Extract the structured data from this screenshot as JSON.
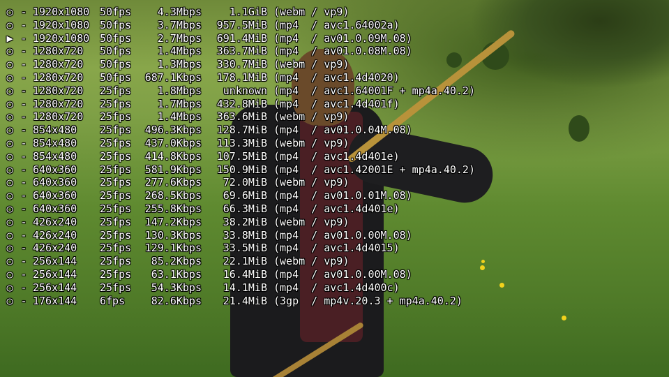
{
  "marker_icons": {
    "unselected": "○",
    "selected": "▶"
  },
  "separator": "-",
  "formats": [
    {
      "selected": false,
      "resolution": "1920x1080",
      "fps": "50fps",
      "bitrate": "4.3Mbps",
      "size": "1.1GiB",
      "codec": "(webm / vp9)"
    },
    {
      "selected": false,
      "resolution": "1920x1080",
      "fps": "50fps",
      "bitrate": "3.7Mbps",
      "size": "957.5MiB",
      "codec": "(mp4  / avc1.64002a)"
    },
    {
      "selected": true,
      "resolution": "1920x1080",
      "fps": "50fps",
      "bitrate": "2.7Mbps",
      "size": "691.4MiB",
      "codec": "(mp4  / av01.0.09M.08)"
    },
    {
      "selected": false,
      "resolution": "1280x720",
      "fps": "50fps",
      "bitrate": "1.4Mbps",
      "size": "363.7MiB",
      "codec": "(mp4  / av01.0.08M.08)"
    },
    {
      "selected": false,
      "resolution": "1280x720",
      "fps": "50fps",
      "bitrate": "1.3Mbps",
      "size": "330.7MiB",
      "codec": "(webm / vp9)"
    },
    {
      "selected": false,
      "resolution": "1280x720",
      "fps": "50fps",
      "bitrate": "687.1Kbps",
      "size": "178.1MiB",
      "codec": "(mp4  / avc1.4d4020)"
    },
    {
      "selected": false,
      "resolution": "1280x720",
      "fps": "25fps",
      "bitrate": "1.8Mbps",
      "size": "unknown",
      "codec": "(mp4  / avc1.64001F + mp4a.40.2)"
    },
    {
      "selected": false,
      "resolution": "1280x720",
      "fps": "25fps",
      "bitrate": "1.7Mbps",
      "size": "432.8MiB",
      "codec": "(mp4  / avc1.4d401f)"
    },
    {
      "selected": false,
      "resolution": "1280x720",
      "fps": "25fps",
      "bitrate": "1.4Mbps",
      "size": "363.6MiB",
      "codec": "(webm / vp9)"
    },
    {
      "selected": false,
      "resolution": "854x480",
      "fps": "25fps",
      "bitrate": "496.3Kbps",
      "size": "128.7MiB",
      "codec": "(mp4  / av01.0.04M.08)"
    },
    {
      "selected": false,
      "resolution": "854x480",
      "fps": "25fps",
      "bitrate": "437.0Kbps",
      "size": "113.3MiB",
      "codec": "(webm / vp9)"
    },
    {
      "selected": false,
      "resolution": "854x480",
      "fps": "25fps",
      "bitrate": "414.8Kbps",
      "size": "107.5MiB",
      "codec": "(mp4  / avc1.4d401e)"
    },
    {
      "selected": false,
      "resolution": "640x360",
      "fps": "25fps",
      "bitrate": "581.9Kbps",
      "size": "150.9MiB",
      "codec": "(mp4  / avc1.42001E + mp4a.40.2)"
    },
    {
      "selected": false,
      "resolution": "640x360",
      "fps": "25fps",
      "bitrate": "277.6Kbps",
      "size": "72.0MiB",
      "codec": "(webm / vp9)"
    },
    {
      "selected": false,
      "resolution": "640x360",
      "fps": "25fps",
      "bitrate": "268.5Kbps",
      "size": "69.6MiB",
      "codec": "(mp4  / av01.0.01M.08)"
    },
    {
      "selected": false,
      "resolution": "640x360",
      "fps": "25fps",
      "bitrate": "255.8Kbps",
      "size": "66.3MiB",
      "codec": "(mp4  / avc1.4d401e)"
    },
    {
      "selected": false,
      "resolution": "426x240",
      "fps": "25fps",
      "bitrate": "147.2Kbps",
      "size": "38.2MiB",
      "codec": "(webm / vp9)"
    },
    {
      "selected": false,
      "resolution": "426x240",
      "fps": "25fps",
      "bitrate": "130.3Kbps",
      "size": "33.8MiB",
      "codec": "(mp4  / av01.0.00M.08)"
    },
    {
      "selected": false,
      "resolution": "426x240",
      "fps": "25fps",
      "bitrate": "129.1Kbps",
      "size": "33.5MiB",
      "codec": "(mp4  / avc1.4d4015)"
    },
    {
      "selected": false,
      "resolution": "256x144",
      "fps": "25fps",
      "bitrate": "85.2Kbps",
      "size": "22.1MiB",
      "codec": "(webm / vp9)"
    },
    {
      "selected": false,
      "resolution": "256x144",
      "fps": "25fps",
      "bitrate": "63.1Kbps",
      "size": "16.4MiB",
      "codec": "(mp4  / av01.0.00M.08)"
    },
    {
      "selected": false,
      "resolution": "256x144",
      "fps": "25fps",
      "bitrate": "54.3Kbps",
      "size": "14.1MiB",
      "codec": "(mp4  / avc1.4d400c)"
    },
    {
      "selected": false,
      "resolution": "176x144",
      "fps": "6fps",
      "bitrate": "82.6Kbps",
      "size": "21.4MiB",
      "codec": "(3gp  / mp4v.20.3 + mp4a.40.2)"
    }
  ]
}
